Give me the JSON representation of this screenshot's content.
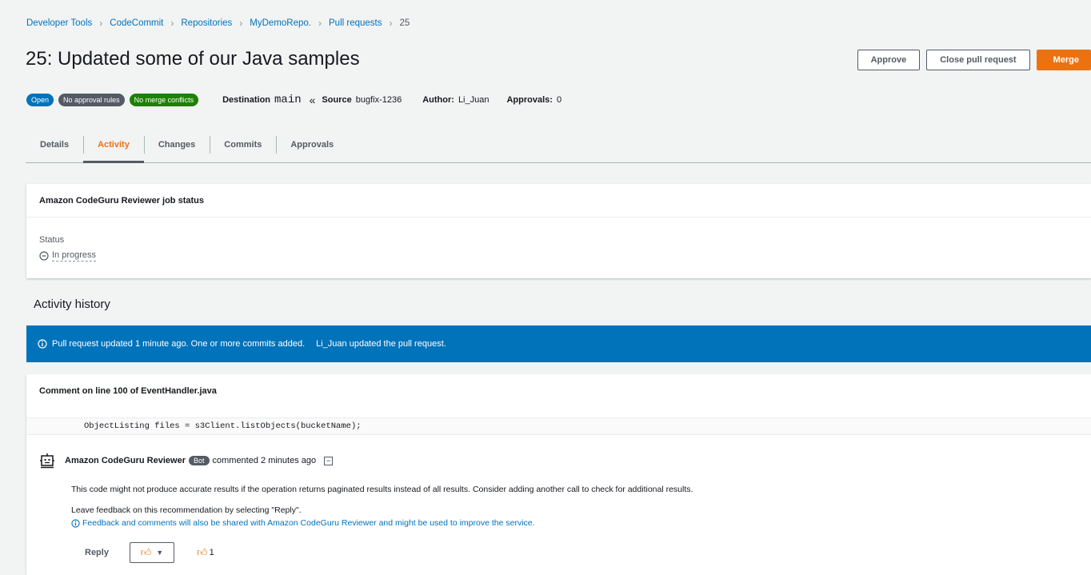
{
  "breadcrumb": [
    "Developer Tools",
    "CodeCommit",
    "Repositories",
    "MyDemoRepo.",
    "Pull requests",
    "25"
  ],
  "page_title": "25: Updated some of our Java samples",
  "actions": {
    "approve": "Approve",
    "close": "Close pull request",
    "merge": "Merge"
  },
  "badges": {
    "open": "Open",
    "approval_rules": "No approval rules",
    "conflicts": "No merge conflicts"
  },
  "meta": {
    "destination_label": "Destination",
    "destination": "main",
    "source_label": "Source",
    "source": "bugfix-1236",
    "author_label": "Author:",
    "author": "Li_Juan",
    "approvals_label": "Approvals:",
    "approvals": "0"
  },
  "tabs": [
    "Details",
    "Activity",
    "Changes",
    "Commits",
    "Approvals"
  ],
  "active_tab": "Activity",
  "job": {
    "title": "Amazon CodeGuru Reviewer job status",
    "status_label": "Status",
    "status_value": "In progress"
  },
  "history": {
    "title": "Activity history",
    "banner_msg": "Pull request updated 1 minute ago. One or more commits added.",
    "banner_msg2": "Li_Juan updated the pull request."
  },
  "comment": {
    "title": "Comment on line 100 of EventHandler.java",
    "code": "ObjectListing files = s3Client.listObjects(bucketName);",
    "author": "Amazon CodeGuru Reviewer",
    "badge": "Bot",
    "time": "commented 2 minutes ago",
    "body": "This code might not produce accurate results if the operation returns paginated results instead of all results. Consider adding another call to check for additional results.",
    "feedback": "Leave feedback on this recommendation by selecting \"Reply\".",
    "info": "Feedback and comments will also be shared with Amazon CodeGuru Reviewer and might be used to improve the service.",
    "reply": "Reply",
    "reaction_count": "1"
  },
  "colors": {
    "accent": "#ec7211",
    "link": "#0073bb",
    "banner": "#0073bb",
    "success": "#1d8102"
  }
}
